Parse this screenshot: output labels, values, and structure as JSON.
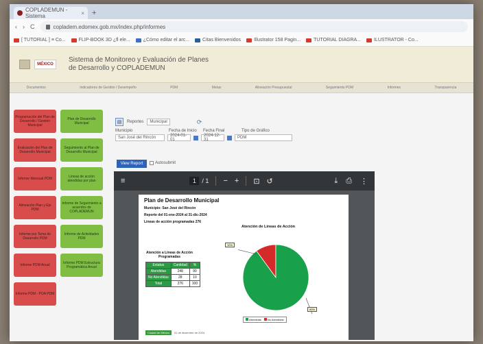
{
  "browser": {
    "tab_title": "COPLADEMUN - Sistema",
    "tab_close": "×",
    "new_tab": "+",
    "nav": {
      "back": "‹",
      "forward": "›",
      "reload": "C"
    },
    "url": "copladem.edomex.gob.mx/index.php/informes",
    "bookmarks": [
      {
        "label": "[ TUTORIAL ] ≡ Co...",
        "color": "#d23b2e"
      },
      {
        "label": "FLIP-BOOK 3D ¿fl ele...",
        "color": "#d23b2e"
      },
      {
        "label": "¿Cómo editar el arc...",
        "color": "#3c6fc7"
      },
      {
        "label": "Citas Bienvenidos",
        "color": "#2c5b9e"
      },
      {
        "label": "Illustrator 158 Pagin...",
        "color": "#d23b2e"
      },
      {
        "label": "TUTORIAL DIAGRA...",
        "color": "#d23b2e"
      },
      {
        "label": "ILUSTRATOR - Co...",
        "color": "#d23b2e"
      }
    ]
  },
  "site": {
    "logo_mex": "MÉXICO",
    "title_line1": "Sistema de Monitoreo y Evaluación de Planes",
    "title_line2": "de Desarrollo y COPLADEMUN",
    "nav_items": [
      "Documentos",
      "Indicadores de Gestión / Desempeño",
      "PDM",
      "Metas",
      "Alineación Presupuestal",
      "Seguimiento PDM",
      "Informes",
      "Transparencia"
    ]
  },
  "sidebar": {
    "left": [
      "Programación del Plan de Desarrollo / Gestión Municipal",
      "Evaluación del Plan de Desarrollo Municipal",
      "Informe Mensual PDM",
      "Alineación Plan y Eje PDM",
      "Informe por Tema de Desarrollo PDM",
      "Informe PDM Anual",
      "Informe PDM - POA PDM"
    ],
    "right": [
      "Plan de Desarrollo Municipal",
      "Seguimiento al Plan de Desarrollo Municipal",
      "Líneas de acción atendidas por plan",
      "Informe de Seguimiento a acuerdos de COPLADEMUN",
      "Informe de Actividades PDM",
      "Informe PDM Estructura Programática Anual"
    ]
  },
  "controls": {
    "page_label": "Reportes",
    "page_value": "Municipal",
    "municipio_label": "Municipio",
    "municipio_value": "San José del Rincón",
    "fecha_inicio_label": "Fecha de Inicio",
    "fecha_inicio_value": "2024-01-01",
    "fecha_final_label": "Fecha Final",
    "fecha_final_value": "2024-12-31",
    "tipo_label": "Tipo de Gráfico",
    "tipo_value": "PDM",
    "view_report": "View Report",
    "auto_label": "Autosubmit"
  },
  "pdf": {
    "page_current": "1",
    "page_total": "/ 1",
    "menu": "≡",
    "zoom_out": "−",
    "zoom_in": "+",
    "fit": "⊡",
    "rotate": "↺",
    "download": "⤓",
    "print": "⎙",
    "more": "⋮"
  },
  "report": {
    "title": "Plan de Desarrollo Municipal",
    "municipio": "Municipio: San José del Rincón",
    "period": "Reporte del 01-ene-2024 al 31-dic-2024",
    "lineas": "Líneas de acción programadas 276",
    "chart_title": "Atención de Líneas de Acción",
    "table_title": "Atención a Líneas de Acción Programadas",
    "table": {
      "headers": [
        "Estatus",
        "Cantidad",
        "%"
      ],
      "rows": [
        [
          "Atendidas",
          "248",
          "90"
        ],
        [
          "No Atendidas",
          "28",
          "10"
        ],
        [
          "Total",
          "276",
          "100"
        ]
      ]
    },
    "pie_label_small": "10%",
    "pie_label_big": "90%",
    "legend": [
      "Atendidas",
      "No Atendidas"
    ],
    "footer_tag": "Ciudad de México",
    "footer_date": "01 de diciembre de 2024"
  },
  "chart_data": {
    "type": "pie",
    "title": "Atención de Líneas de Acción",
    "categories": [
      "Atendidas",
      "No Atendidas"
    ],
    "values": [
      90,
      10
    ],
    "colors": [
      "#18a04a",
      "#d42a2a"
    ]
  }
}
